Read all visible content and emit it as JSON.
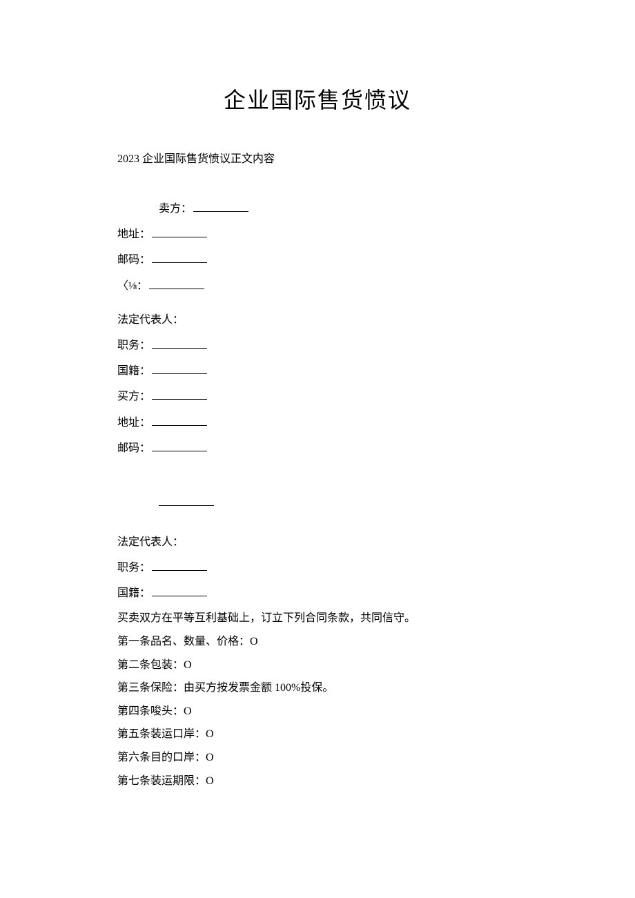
{
  "title": "企业国际售货愤议",
  "subtitle": "2023 企业国际售货愤议正文内容",
  "seller": {
    "label": "卖方：",
    "address_label": "地址：",
    "postcode_label": "邮码：",
    "phone_label": "〈⅛：",
    "rep_label": "法定代表人：",
    "position_label": "职务：",
    "nationality_label": "国籍："
  },
  "buyer": {
    "label": "买方：",
    "address_label": "地址：",
    "postcode_label": "邮码：",
    "rep_label": "法定代表人：",
    "position_label": "职务：",
    "nationality_label": "国籍："
  },
  "preamble": "买卖双方在平等互利基础上，订立下列合同条款，共同信守。",
  "articles": {
    "a1": "第一条品名、数量、价格：O",
    "a2": "第二条包装：O",
    "a3": "第三条保险：由买方按发票金额 100%投保。",
    "a4": "第四条唆头：O",
    "a5": "第五条装运口岸：O",
    "a6": "第六条目的口岸：O",
    "a7": "第七条装运期限：O"
  }
}
